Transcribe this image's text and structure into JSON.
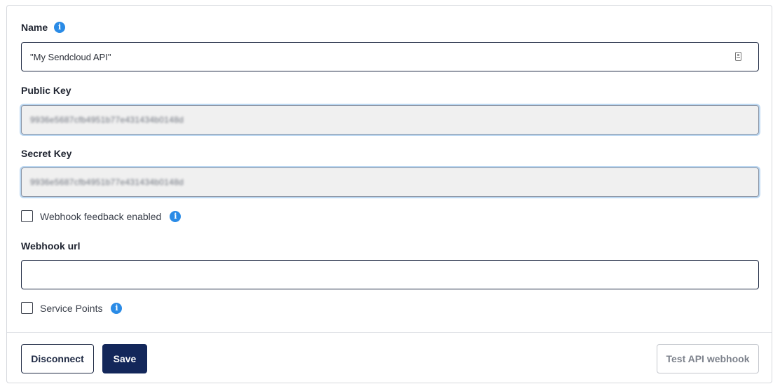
{
  "form": {
    "name": {
      "label": "Name",
      "value": "\"My Sendcloud API\""
    },
    "public_key": {
      "label": "Public Key",
      "value": "9936e5687cfb4951b77e431434b0148d"
    },
    "secret_key": {
      "label": "Secret Key",
      "value": "9936e5687cfb4951b77e431434b0148d"
    },
    "webhook_feedback": {
      "label": "Webhook feedback enabled",
      "checked": false
    },
    "webhook_url": {
      "label": "Webhook url",
      "value": ""
    },
    "service_points": {
      "label": "Service Points",
      "checked": false
    }
  },
  "actions": {
    "disconnect_label": "Disconnect",
    "save_label": "Save",
    "test_label": "Test API webhook"
  },
  "icons": {
    "info": "info-icon",
    "contact_card": "contact-card-icon"
  },
  "colors": {
    "primary": "#13275a",
    "info": "#2a8be6",
    "focus_ring": "#bcd8f2"
  }
}
